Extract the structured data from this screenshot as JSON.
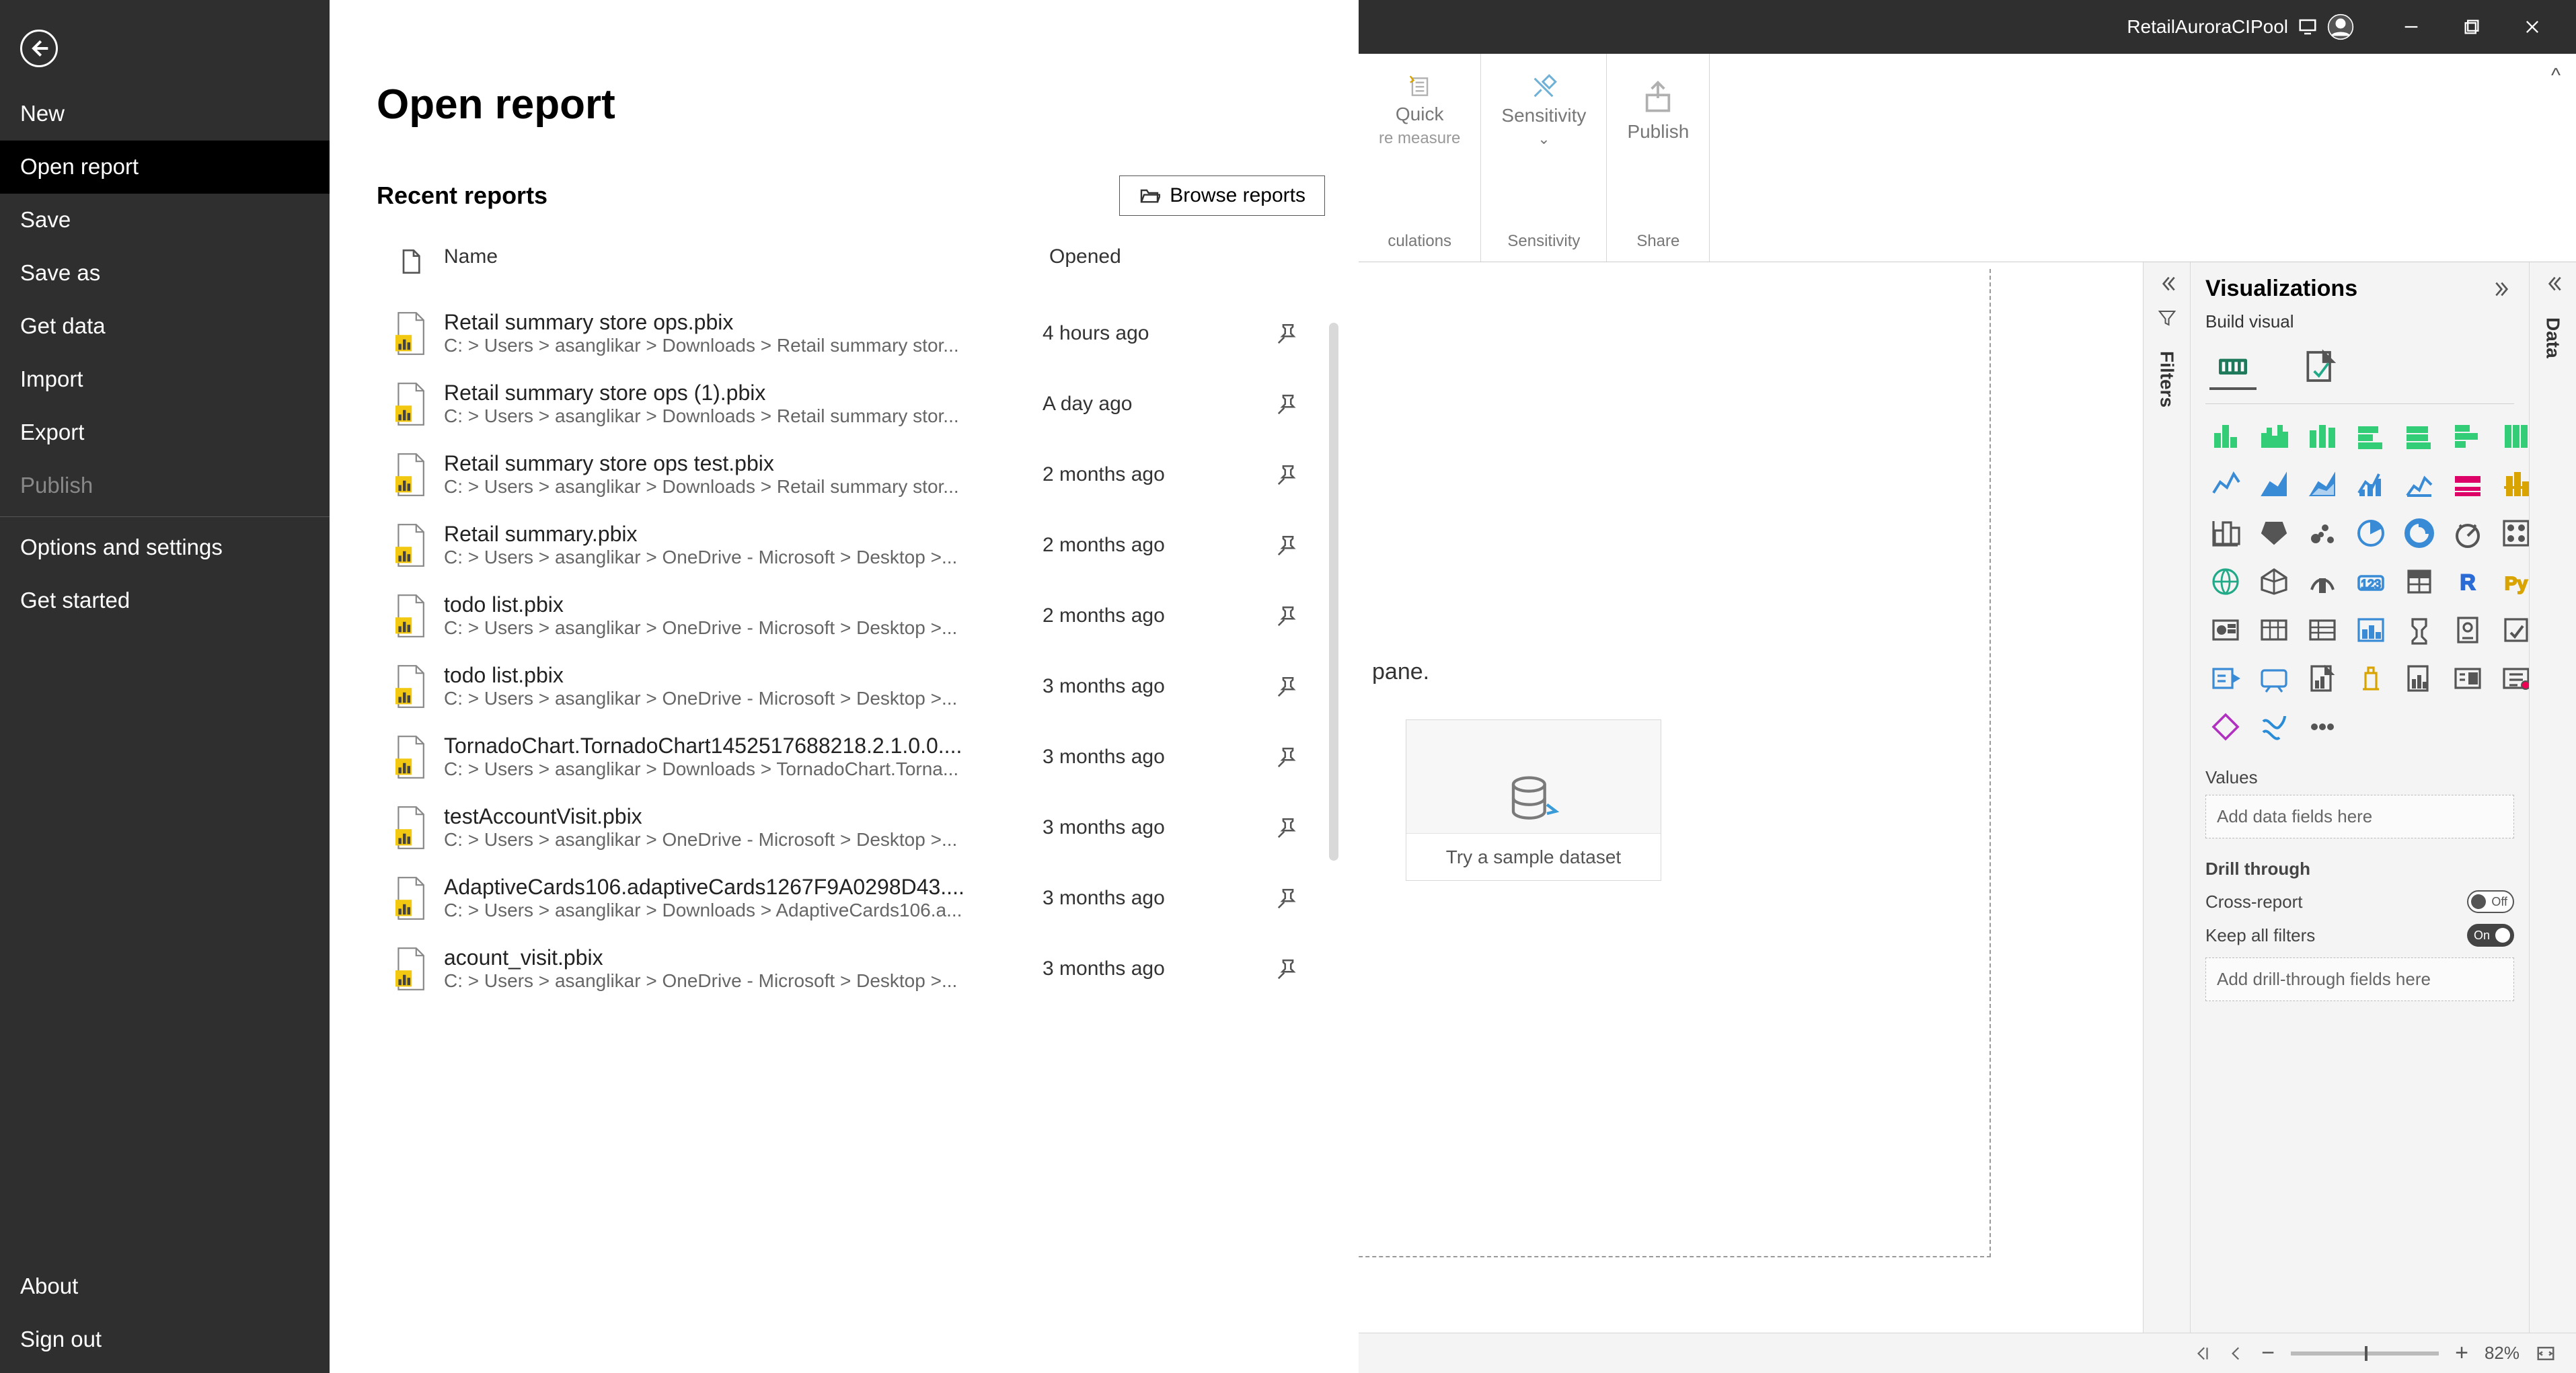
{
  "titlebar": {
    "account": "RetailAuroraCIPool"
  },
  "backstage": {
    "items": [
      {
        "id": "new",
        "label": "New"
      },
      {
        "id": "open",
        "label": "Open report",
        "active": true
      },
      {
        "id": "save",
        "label": "Save"
      },
      {
        "id": "saveas",
        "label": "Save as"
      },
      {
        "id": "getdata",
        "label": "Get data"
      },
      {
        "id": "import",
        "label": "Import"
      },
      {
        "id": "export",
        "label": "Export"
      },
      {
        "id": "publish",
        "label": "Publish",
        "disabled": true
      },
      {
        "id": "options",
        "label": "Options and settings",
        "sep": true
      },
      {
        "id": "started",
        "label": "Get started"
      }
    ],
    "bottom": [
      {
        "id": "about",
        "label": "About"
      },
      {
        "id": "signout",
        "label": "Sign out"
      }
    ]
  },
  "open_panel": {
    "title": "Open report",
    "recent_label": "Recent reports",
    "browse_label": "Browse reports",
    "col_name": "Name",
    "col_opened": "Opened",
    "rows": [
      {
        "name": "Retail summary store ops.pbix",
        "path": "C: > Users > asanglikar > Downloads > Retail summary stor...",
        "opened": "4 hours ago"
      },
      {
        "name": "Retail summary store ops (1).pbix",
        "path": "C: > Users > asanglikar > Downloads > Retail summary stor...",
        "opened": "A day ago"
      },
      {
        "name": "Retail summary store ops test.pbix",
        "path": "C: > Users > asanglikar > Downloads > Retail summary stor...",
        "opened": "2 months ago"
      },
      {
        "name": "Retail summary.pbix",
        "path": "C: > Users > asanglikar > OneDrive - Microsoft > Desktop >...",
        "opened": "2 months ago"
      },
      {
        "name": "todo list.pbix",
        "path": "C: > Users > asanglikar > OneDrive - Microsoft > Desktop >...",
        "opened": "2 months ago"
      },
      {
        "name": "todo list.pbix",
        "path": "C: > Users > asanglikar > OneDrive - Microsoft > Desktop >...",
        "opened": "3 months ago"
      },
      {
        "name": "TornadoChart.TornadoChart1452517688218.2.1.0.0....",
        "path": "C: > Users > asanglikar > Downloads > TornadoChart.Torna...",
        "opened": "3 months ago"
      },
      {
        "name": "testAccountVisit.pbix",
        "path": "C: > Users > asanglikar > OneDrive - Microsoft > Desktop >...",
        "opened": "3 months ago"
      },
      {
        "name": "AdaptiveCards106.adaptiveCards1267F9A0298D43....",
        "path": "C: > Users > asanglikar > Downloads > AdaptiveCards106.a...",
        "opened": "3 months ago"
      },
      {
        "name": "acount_visit.pbix",
        "path": "C: > Users > asanglikar > OneDrive - Microsoft > Desktop >...",
        "opened": "3 months ago"
      }
    ]
  },
  "ribbon": {
    "groups": [
      {
        "name": "Quick",
        "sub": "re measure",
        "footer": "culations"
      },
      {
        "name": "Sensitivity",
        "sub": "⌄",
        "footer": "Sensitivity"
      },
      {
        "name": "Publish",
        "sub": "",
        "footer": "Share"
      }
    ]
  },
  "canvas": {
    "hint": "pane.",
    "sample": "Try a sample dataset"
  },
  "viz": {
    "title": "Visualizations",
    "tab": "Build visual",
    "values": "Values",
    "values_ph": "Add data fields here",
    "drill": "Drill through",
    "cross": "Cross-report",
    "cross_state": "Off",
    "keep": "Keep all filters",
    "keep_state": "On",
    "drill_ph": "Add drill-through fields here"
  },
  "rails": {
    "filters": "Filters",
    "data": "Data"
  },
  "status": {
    "zoom": "82%"
  }
}
